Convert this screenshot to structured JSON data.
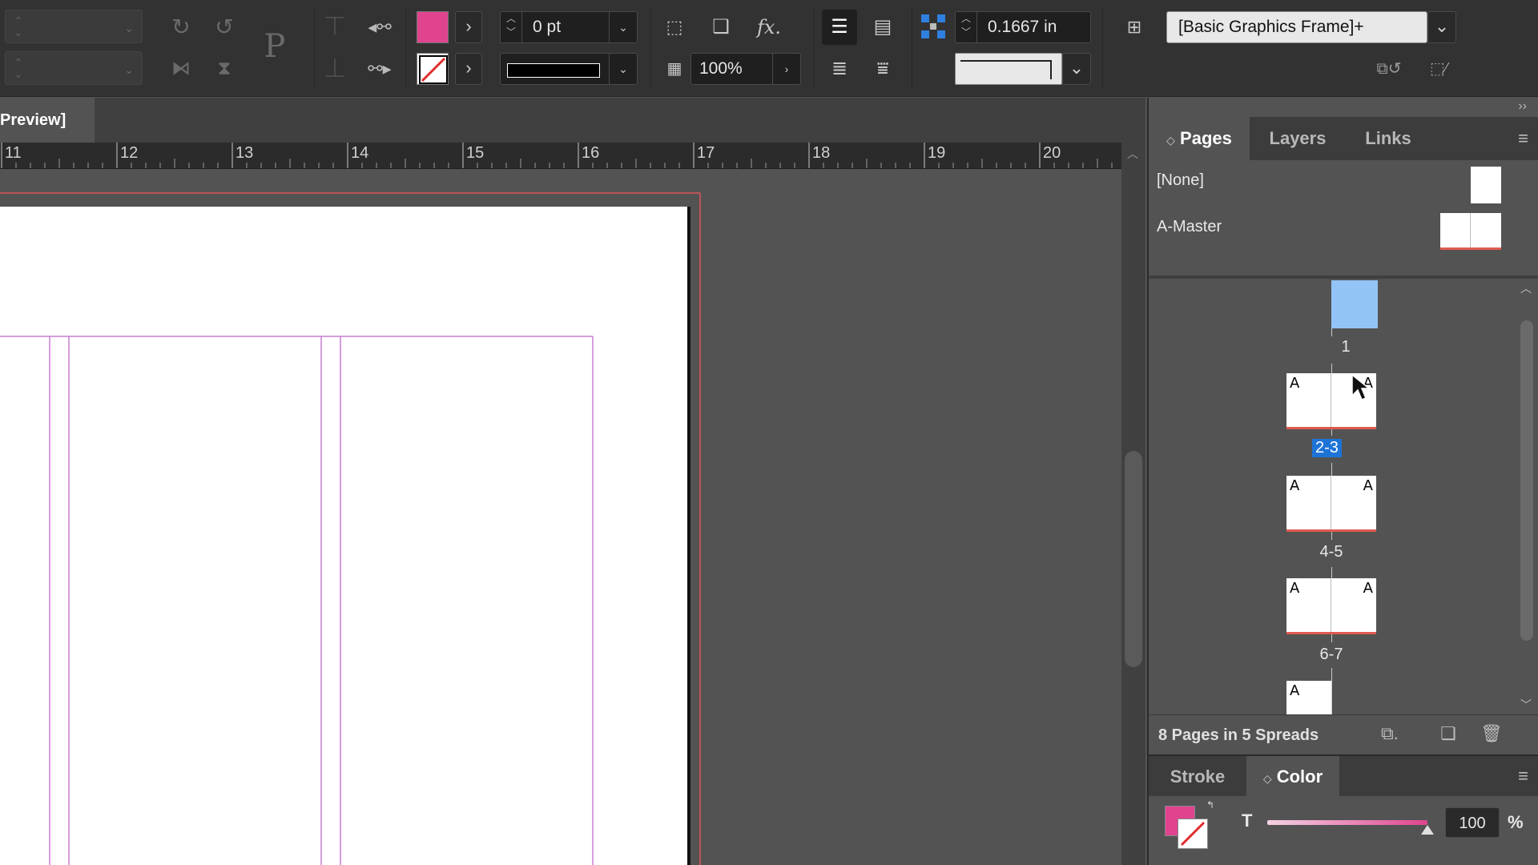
{
  "control_bar": {
    "fill_color": "#e0448f",
    "stroke_weight": "0 pt",
    "opacity": "100%",
    "gap_value": "0.1667 in",
    "object_style": "[Basic Graphics Frame]+",
    "icons": {
      "rotate_cw": "rotate-clockwise-icon",
      "rotate_ccw": "rotate-counterclockwise-icon",
      "text_frame": "text-frame-p-icon"
    }
  },
  "document": {
    "tab_label": "Preview]",
    "ruler_ticks": [
      "11",
      "12",
      "13",
      "14",
      "15",
      "16",
      "17",
      "18",
      "19",
      "20"
    ],
    "margin_guide_color": "#c97fd0",
    "bleed_guide_color": "#e0585a"
  },
  "pages_panel": {
    "tabs": [
      {
        "label": "Pages",
        "active": true
      },
      {
        "label": "Layers",
        "active": false
      },
      {
        "label": "Links",
        "active": false
      }
    ],
    "masters": [
      {
        "label": "[None]"
      },
      {
        "label": "A-Master"
      }
    ],
    "master_prefix": "A",
    "spreads": [
      {
        "label": "1",
        "selected": false
      },
      {
        "label": "2-3",
        "selected": true
      },
      {
        "label": "4-5",
        "selected": false
      },
      {
        "label": "6-7",
        "selected": false
      },
      {
        "label": "",
        "selected": false
      }
    ],
    "footer_count": "8 Pages in 5 Spreads"
  },
  "color_panel": {
    "tabs": [
      {
        "label": "Stroke",
        "active": false
      },
      {
        "label": "Color",
        "active": true
      }
    ],
    "tint_label": "T",
    "tint_value": "100",
    "tint_unit": "%",
    "swatch_color": "#e0448f",
    "tint_level": 1.0
  }
}
